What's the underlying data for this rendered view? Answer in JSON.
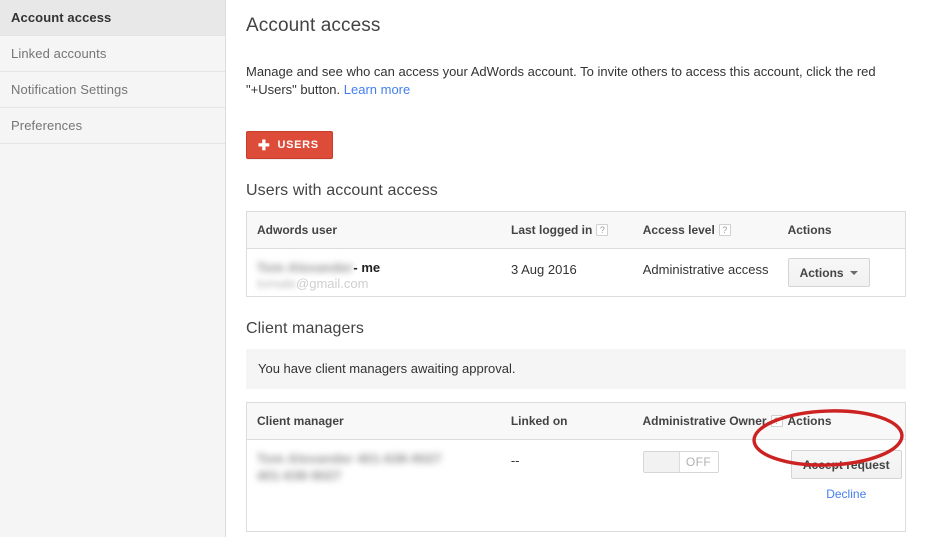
{
  "sidebar": {
    "items": [
      {
        "label": "Account access",
        "active": true
      },
      {
        "label": "Linked accounts",
        "active": false
      },
      {
        "label": "Notification Settings",
        "active": false
      },
      {
        "label": "Preferences",
        "active": false
      }
    ]
  },
  "main": {
    "page_title": "Account access",
    "description_part1": "Manage and see who can access your AdWords account. To invite others to access this account, click the red \"+Users\" button. ",
    "learn_more_label": "Learn more",
    "users_button": {
      "label": "USERS",
      "icon": "plus-icon",
      "color": "#dd4b39"
    }
  },
  "users_section": {
    "title": "Users with account access",
    "columns": [
      {
        "label": "Adwords user",
        "help": false
      },
      {
        "label": "Last logged in",
        "help": true,
        "help_glyph": "?"
      },
      {
        "label": "Access level",
        "help": true,
        "help_glyph": "?"
      },
      {
        "label": "Actions",
        "help": false
      }
    ],
    "rows": [
      {
        "user_name_redacted": "Tom Alexander",
        "user_suffix": "- me",
        "user_email_redacted": "tomale",
        "user_email_domain": "@gmail.com",
        "last_logged_in": "3 Aug 2016",
        "access_level": "Administrative access",
        "action_label": "Actions",
        "action_icon": "chevron-down-icon"
      }
    ]
  },
  "client_managers_section": {
    "title": "Client managers",
    "notice": "You have client managers awaiting approval.",
    "columns": [
      {
        "label": "Client manager",
        "help": false
      },
      {
        "label": "Linked on",
        "help": false
      },
      {
        "label": "Administrative Owner",
        "help": true,
        "help_glyph": "?"
      },
      {
        "label": "Actions",
        "help": false
      }
    ],
    "rows": [
      {
        "manager_line1_redacted": "Tom Alexander 401-638-9027",
        "manager_line2_redacted": "401-638-9027",
        "linked_on": "--",
        "admin_owner_toggle": {
          "state": "OFF",
          "label": "OFF"
        },
        "accept_label": "Accept request",
        "decline_label": "Decline"
      }
    ]
  },
  "annotation": {
    "shape": "ellipse-highlight",
    "color": "#cc2222",
    "target": "accept-request-button"
  },
  "colors": {
    "accent_red": "#dd4b39",
    "link_blue": "#427fed",
    "sidebar_bg": "#f5f5f5",
    "sidebar_active_bg": "#e8e8e8",
    "border": "#dcdcdc",
    "annotation_red": "#cc2222"
  }
}
